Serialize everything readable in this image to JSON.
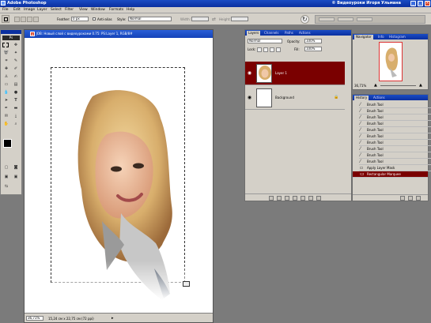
{
  "app": {
    "title": "Adobe Photoshop",
    "user": "© Видеоуроки Игоря Ульмана"
  },
  "menu": [
    "File",
    "Edit",
    "Image",
    "Layer",
    "Select",
    "Filter",
    "View",
    "Window",
    "Formats",
    "Help"
  ],
  "options": {
    "feather_label": "Feather:",
    "feather_value": "0 px",
    "antialias_label": "Anti-alias",
    "style_label": "Style:",
    "style_value": "Normal",
    "width_label": "Width:",
    "height_label": "Height:"
  },
  "document": {
    "title": "75. JOB: Новый слой с видеоуроками 0.75: PS:Layer 1, RGB/8#"
  },
  "status": {
    "zoom": "36,71%",
    "doc_size": "15,24 см x 22,75 см (72 ppi)"
  },
  "layers_panel": {
    "tabs": [
      "Layers",
      "Channels",
      "Paths",
      "Actions"
    ],
    "blend_mode": "Normal",
    "opacity_label": "Opacity:",
    "opacity_value": "100%",
    "lock_label": "Lock:",
    "fill_label": "Fill:",
    "fill_value": "100%",
    "layers": [
      {
        "name": "Layer 1",
        "selected": true
      },
      {
        "name": "Background",
        "selected": false
      }
    ]
  },
  "navigator_panel": {
    "tabs": [
      "Navigator",
      "Info",
      "Histogram"
    ],
    "zoom": "36,71%"
  },
  "history_panel": {
    "tabs": [
      "History",
      "Actions"
    ],
    "items": [
      "Brush Tool",
      "Brush Tool",
      "Brush Tool",
      "Brush Tool",
      "Brush Tool",
      "Brush Tool",
      "Brush Tool",
      "Brush Tool",
      "Brush Tool",
      "Brush Tool",
      "Apply Layer Mask",
      "Rectangular Marquee"
    ],
    "selected_index": 11
  },
  "colors": {
    "selected_layer": "#7a0000",
    "title_blue": "#0a2fa0",
    "panel_gray": "#d4d0c8"
  }
}
